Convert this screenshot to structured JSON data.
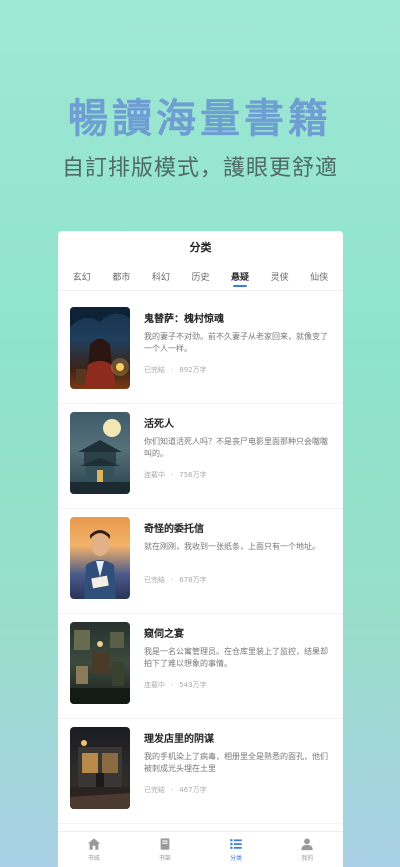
{
  "promo": {
    "title": "暢讀海量書籍",
    "subtitle": "自訂排版模式，護眼更舒適"
  },
  "header": {
    "title": "分类"
  },
  "tabs": [
    {
      "label": "玄幻"
    },
    {
      "label": "都市"
    },
    {
      "label": "科幻"
    },
    {
      "label": "历史"
    },
    {
      "label": "悬疑",
      "active": true
    },
    {
      "label": "灵侠"
    },
    {
      "label": "仙侠"
    }
  ],
  "books": [
    {
      "title": "鬼替萨：槐村惊魂",
      "desc": "我的妻子不对劲。前不久妻子从老家回来，就像变了一个人一样。",
      "status": "已完结",
      "words": "892万字"
    },
    {
      "title": "活死人",
      "desc": "你们知道活死人吗？不是丧尸电影里面那种只会嗷嗷叫的。",
      "status": "连载中",
      "words": "756万字"
    },
    {
      "title": "奇怪的委托信",
      "desc": "就在刚刚，我收到一张纸条，上面只有一个地址。",
      "status": "已完结",
      "words": "678万字"
    },
    {
      "title": "窥伺之宴",
      "desc": "我是一名公寓管理员。在仓库里装上了监控，结果却拍下了难以想象的事情。",
      "status": "连载中",
      "words": "543万字"
    },
    {
      "title": "理发店里的阴谋",
      "desc": "我的手机染上了病毒，相册里全是熟悉的面孔，他们被刺成光头埋在土里",
      "status": "已完结",
      "words": "467万字"
    }
  ],
  "nav": [
    {
      "label": "书城",
      "icon": "home-icon"
    },
    {
      "label": "书架",
      "icon": "bookshelf-icon"
    },
    {
      "label": "分类",
      "icon": "category-list-icon",
      "active": true
    },
    {
      "label": "我的",
      "icon": "user-icon"
    }
  ],
  "colors": {
    "accent": "#3b7be0",
    "promo_title": "#6f9ed3",
    "background_top": "#9fe8d6",
    "background_bottom": "#a9d0e6"
  }
}
